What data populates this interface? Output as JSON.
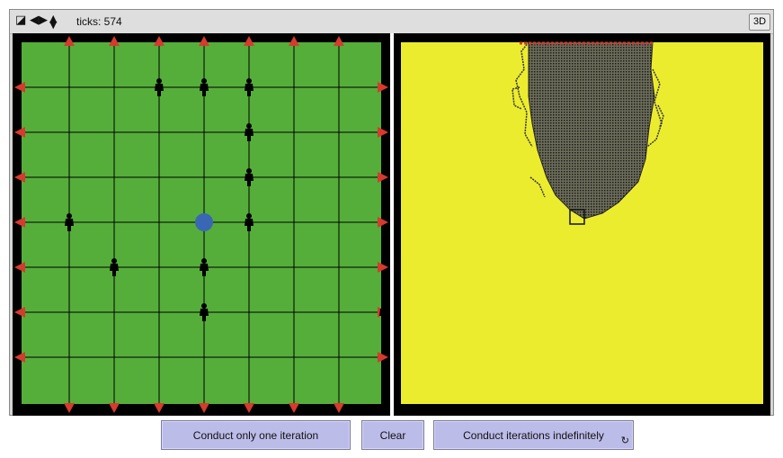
{
  "toolbar": {
    "ticks_label": "ticks: 574",
    "button_3d": "3D",
    "icons": [
      "zoom-icon",
      "horizontal-arrows-icon",
      "vertical-arrows-icon"
    ]
  },
  "colors": {
    "world_left": "#55ae3a",
    "world_right": "#ecec2f",
    "arrow": "#d73a2e",
    "center_node": "#3a67b4",
    "people": "#000000",
    "trail": "#333333",
    "button_bg": "#bcbce9"
  },
  "buttons": {
    "one_iteration": "Conduct only one iteration",
    "clear": "Clear",
    "indefinitely": "Conduct iterations indefinitely",
    "forever_icon": "↻"
  }
}
